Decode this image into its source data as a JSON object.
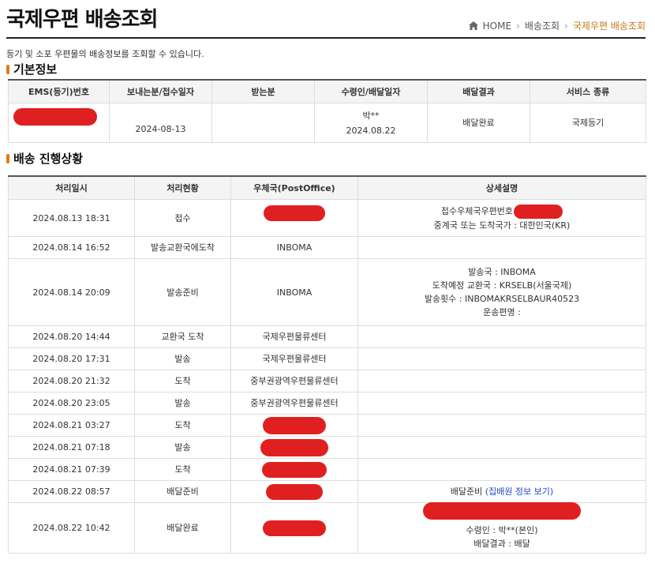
{
  "header": {
    "title": "국제우편 배송조회",
    "breadcrumb": [
      "HOME",
      "배송조회",
      "국제우편 배송조회"
    ],
    "description": "등기 및 소포 우편물의 배송정보를 조회할 수 있습니다."
  },
  "basic_info": {
    "section_title": "기본정보",
    "columns": [
      "EMS(등기)번호",
      "보내는분/접수일자",
      "받는분",
      "수령인/배달일자",
      "배달결과",
      "서비스 종류"
    ],
    "row": {
      "sender_date": "2024-08-13",
      "receiver": "",
      "recipient_name": "박**",
      "recipient_date": "2024.08.22",
      "result": "배달완료",
      "service": "국제등기"
    }
  },
  "progress": {
    "section_title": "배송 진행상황",
    "columns": [
      "처리일시",
      "처리현황",
      "우체국(PostOffice)",
      "상세설명"
    ],
    "rows": [
      {
        "datetime": "2024.08.13 18:31",
        "status": "접수",
        "office": "",
        "details": [
          "접수우체국우편번호 :",
          "중계국 또는 도착국가 : 대한민국(KR)"
        ]
      },
      {
        "datetime": "2024.08.14 16:52",
        "status": "발송교환국에도착",
        "office": "INBOMA",
        "details": []
      },
      {
        "datetime": "2024.08.14 20:09",
        "status": "발송준비",
        "office": "INBOMA",
        "details": [
          "발송국 : INBOMA",
          "도착예정 교환국 : KRSELB(서울국제)",
          "발송횟수 : INBOMAKRSELBAUR40523",
          "운송편명 :"
        ]
      },
      {
        "datetime": "2024.08.20 14:44",
        "status": "교환국 도착",
        "office": "국제우편물류센터",
        "details": []
      },
      {
        "datetime": "2024.08.20 17:31",
        "status": "발송",
        "office": "국제우편물류센터",
        "details": []
      },
      {
        "datetime": "2024.08.20 21:32",
        "status": "도착",
        "office": "중부권광역우편물류센터",
        "details": []
      },
      {
        "datetime": "2024.08.20 23:05",
        "status": "발송",
        "office": "중부권광역우편물류센터",
        "details": []
      },
      {
        "datetime": "2024.08.21 03:27",
        "status": "도착",
        "office": "",
        "details": []
      },
      {
        "datetime": "2024.08.21 07:18",
        "status": "발송",
        "office": "",
        "details": []
      },
      {
        "datetime": "2024.08.21 07:39",
        "status": "도착",
        "office": "",
        "details": []
      },
      {
        "datetime": "2024.08.22 08:57",
        "status": "배달준비",
        "office": "",
        "details_prefix": "배달준비",
        "details_link": "(집배원 정보 보기)"
      },
      {
        "datetime": "2024.08.22 10:42",
        "status": "배달완료",
        "office": "",
        "details": [
          "수령인 : 박**(본인)",
          "배달결과 : 배달"
        ]
      }
    ]
  },
  "colors": {
    "accent": "#e07a12",
    "breadcrumb_current": "#c77a1a",
    "redaction": "#e02020",
    "link": "#2048c8"
  }
}
